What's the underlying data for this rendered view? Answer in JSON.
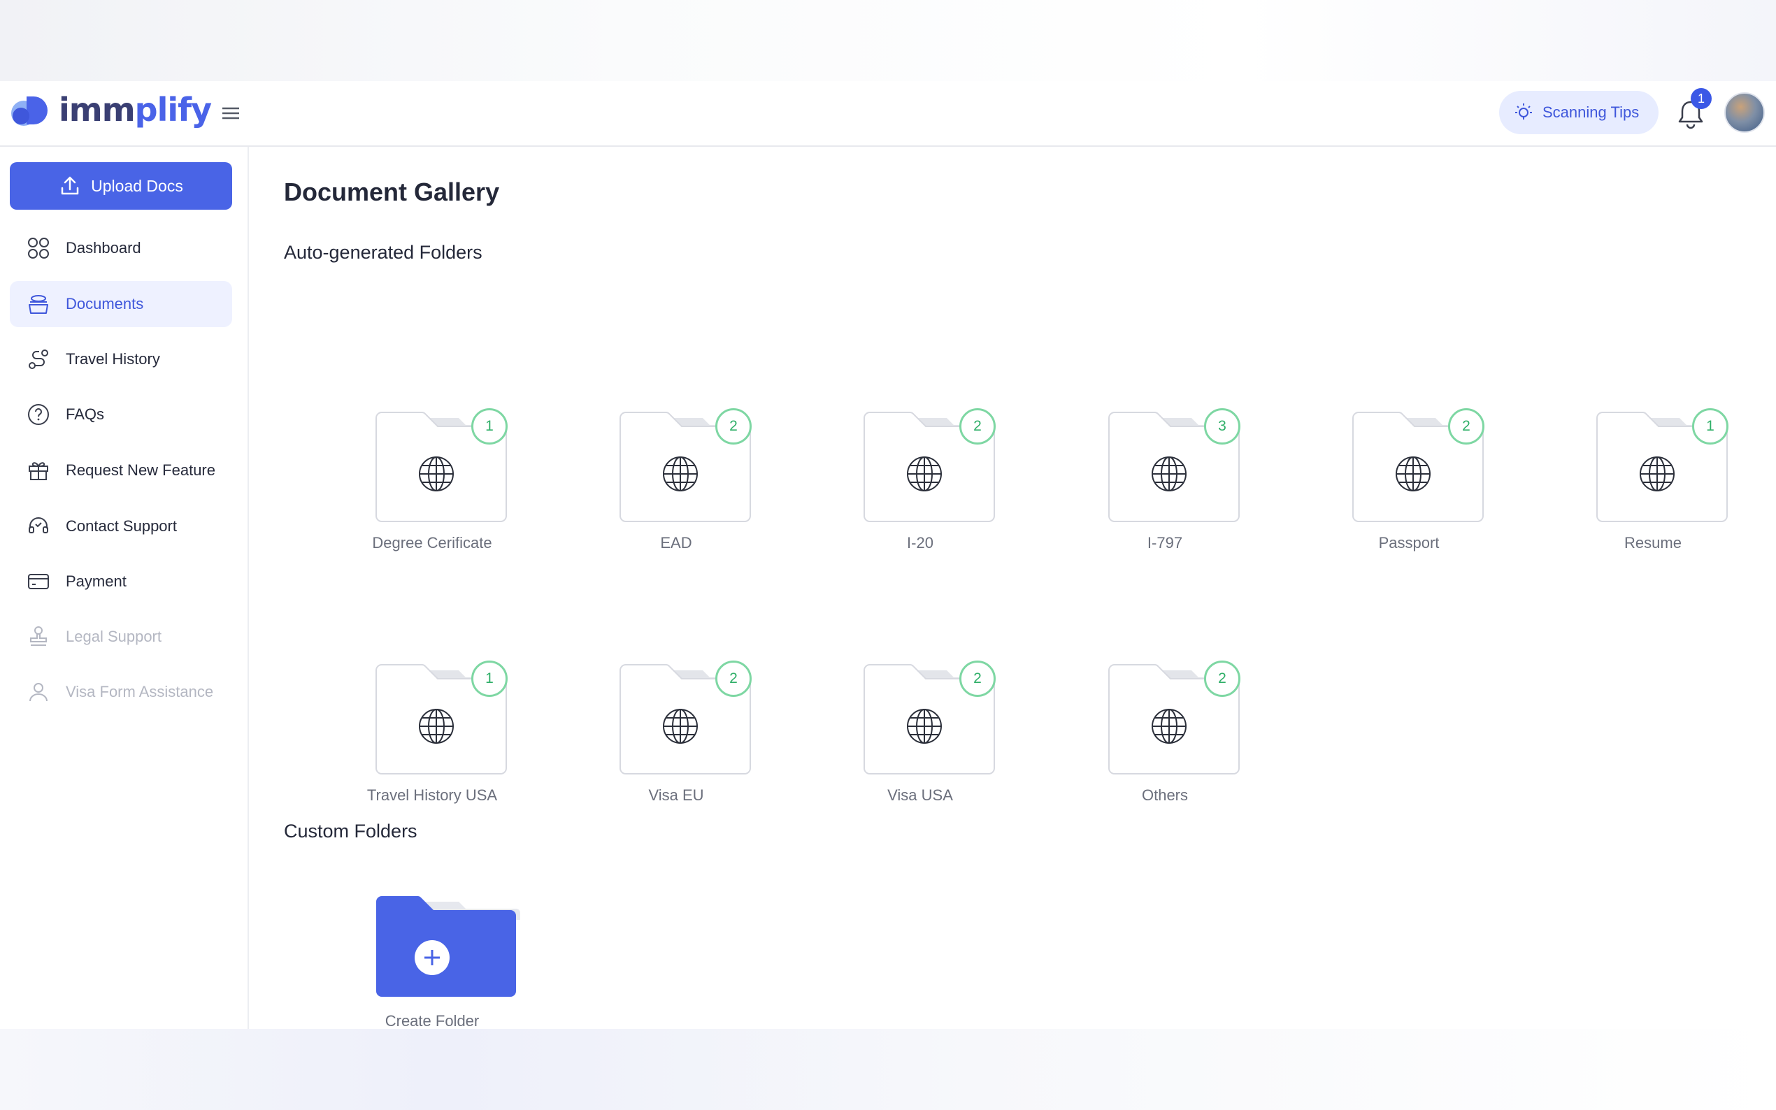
{
  "header": {
    "logo_text_dark": "imm",
    "logo_text_accent": "plify",
    "scanning_tips_label": "Scanning Tips",
    "notification_count": "1"
  },
  "sidebar": {
    "upload_label": "Upload Docs",
    "items": [
      {
        "label": "Dashboard",
        "icon": "dashboard-grid-icon",
        "state": "normal"
      },
      {
        "label": "Documents",
        "icon": "documents-stack-icon",
        "state": "active"
      },
      {
        "label": "Travel History",
        "icon": "route-icon",
        "state": "normal"
      },
      {
        "label": "FAQs",
        "icon": "question-circle-icon",
        "state": "normal"
      },
      {
        "label": "Request New Feature",
        "icon": "gift-icon",
        "state": "normal"
      },
      {
        "label": "Contact Support",
        "icon": "headset-icon",
        "state": "normal"
      },
      {
        "label": "Payment",
        "icon": "credit-card-icon",
        "state": "normal"
      },
      {
        "label": "Legal Support",
        "icon": "stamp-icon",
        "state": "disabled"
      },
      {
        "label": "Visa Form Assistance",
        "icon": "user-icon",
        "state": "disabled"
      }
    ]
  },
  "main": {
    "page_title": "Document Gallery",
    "auto_section_title": "Auto-generated Folders",
    "auto_folders": [
      {
        "label": "Degree Cerificate",
        "count": "1"
      },
      {
        "label": "EAD",
        "count": "2"
      },
      {
        "label": "I-20",
        "count": "2"
      },
      {
        "label": "I-797",
        "count": "3"
      },
      {
        "label": "Passport",
        "count": "2"
      },
      {
        "label": "Resume",
        "count": "1"
      },
      {
        "label": "Travel History USA",
        "count": "1"
      },
      {
        "label": "Visa EU",
        "count": "2"
      },
      {
        "label": "Visa USA",
        "count": "2"
      },
      {
        "label": "Others",
        "count": "2"
      }
    ],
    "custom_section_title": "Custom Folders",
    "create_folder_label": "Create Folder"
  },
  "colors": {
    "primary": "#4964e6",
    "active_bg": "#eef1ff",
    "badge_green": "#2faf68",
    "badge_border": "#7ed7a3"
  }
}
